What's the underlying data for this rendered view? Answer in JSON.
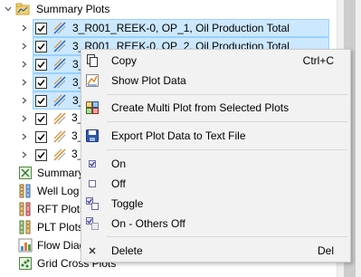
{
  "tree": {
    "parent": {
      "label": "Summary Plots"
    },
    "plots": [
      {
        "label": "3_R001_REEK-0, OP_1, Oil Production Total",
        "selected": true
      },
      {
        "label": "3_R001_REEK-0, OP_2, Oil Production Total",
        "selected": true
      },
      {
        "label": "3_",
        "selected": true
      },
      {
        "label": "3_",
        "selected": true
      },
      {
        "label": "3_",
        "selected": true
      },
      {
        "label": "3_",
        "selected": false
      },
      {
        "label": "3_",
        "selected": false
      },
      {
        "label": "3_",
        "selected": false
      }
    ],
    "collections": [
      {
        "label": "Summary",
        "icon": "summary-crossplot-icon"
      },
      {
        "label": "Well Log",
        "icon": "well-log-icon"
      },
      {
        "label": "RFT Plots",
        "icon": "rft-plots-icon"
      },
      {
        "label": "PLT Plots",
        "icon": "plt-plots-icon"
      },
      {
        "label": "Flow Diag",
        "icon": "flow-diagnostics-icon"
      },
      {
        "label": "Grid Cross Plots",
        "icon": "grid-cross-plots-icon"
      }
    ]
  },
  "menu": {
    "items": [
      {
        "label": "Copy",
        "shortcut": "Ctrl+C",
        "icon": "copy-icon"
      },
      {
        "label": "Show Plot Data",
        "shortcut": "",
        "icon": "plot-data-icon"
      },
      {
        "label": "Create Multi Plot from Selected Plots",
        "shortcut": "",
        "icon": "multi-plot-icon"
      },
      {
        "label": "Export Plot Data to Text File",
        "shortcut": "",
        "icon": "save-icon"
      },
      {
        "label": "On",
        "shortcut": "",
        "icon": "check-on-icon"
      },
      {
        "label": "Off",
        "shortcut": "",
        "icon": "check-off-icon"
      },
      {
        "label": "Toggle",
        "shortcut": "",
        "icon": "toggle-icon"
      },
      {
        "label": "On - Others Off",
        "shortcut": "",
        "icon": "on-others-off-icon"
      },
      {
        "label": "Delete",
        "shortcut": "Del",
        "icon": "delete-icon"
      }
    ]
  },
  "colors": {
    "selection_bg": "#cce8ff",
    "selection_border": "#99d1ff",
    "menu_bg": "#f2f2f2",
    "curve_blue": "#1f5fbf",
    "curve_orange": "#d88a2a"
  }
}
